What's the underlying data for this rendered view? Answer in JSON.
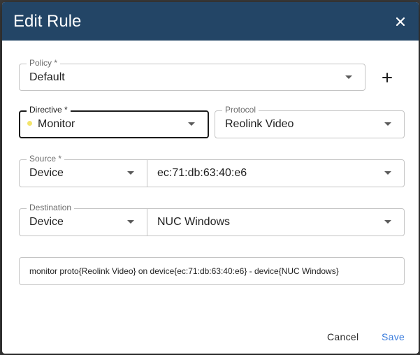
{
  "dialog": {
    "title": "Edit Rule",
    "close_icon": "close-icon"
  },
  "policy": {
    "label": "Policy *",
    "value": "Default"
  },
  "add_icon": "plus-icon",
  "directive": {
    "label": "Directive *",
    "value": "Monitor",
    "indicator_color": "#f3e46b"
  },
  "protocol": {
    "label": "Protocol",
    "value": "Reolink Video"
  },
  "source": {
    "label": "Source *",
    "type": "Device",
    "value": "ec:71:db:63:40:e6"
  },
  "destination": {
    "label": "Destination",
    "type": "Device",
    "value": "NUC Windows"
  },
  "rule_text": "monitor proto{Reolink Video} on device{ec:71:db:63:40:e6} - device{NUC Windows}",
  "actions": {
    "cancel_label": "Cancel",
    "save_label": "Save"
  },
  "colors": {
    "header": "#234566",
    "accent": "#3b7ddd"
  }
}
